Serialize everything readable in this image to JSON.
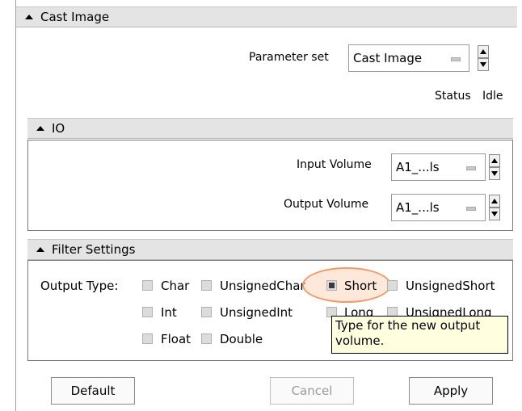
{
  "title": "Cast Image",
  "parameter_set": {
    "label": "Parameter set",
    "value": "Cast Image"
  },
  "status": {
    "label": "Status",
    "value": "Idle"
  },
  "io": {
    "title": "IO",
    "input": {
      "label": "Input Volume",
      "value": "A1_...ls"
    },
    "output": {
      "label": "Output Volume",
      "value": "A1_...ls"
    }
  },
  "filter": {
    "title": "Filter Settings",
    "output_type_label": "Output Type:",
    "options": {
      "char": {
        "label": "Char",
        "checked": false
      },
      "uchar": {
        "label": "UnsignedChar",
        "checked": false
      },
      "short": {
        "label": "Short",
        "checked": true
      },
      "ushort": {
        "label": "UnsignedShort",
        "checked": false
      },
      "int": {
        "label": "Int",
        "checked": false
      },
      "uint": {
        "label": "UnsignedInt",
        "checked": false
      },
      "long": {
        "label": "Long",
        "checked": false
      },
      "ulong": {
        "label": "UnsignedLong",
        "checked": false
      },
      "float": {
        "label": "Float",
        "checked": false
      },
      "double": {
        "label": "Double",
        "checked": false
      }
    }
  },
  "tooltip": {
    "line1": "Type for the new output",
    "line2": "volume."
  },
  "buttons": {
    "default": "Default",
    "cancel": "Cancel",
    "apply": "Apply"
  },
  "colors": {
    "header_bg": "#e4e4e4",
    "tooltip_bg": "#ffffe0",
    "highlight": "#f19a6a"
  }
}
